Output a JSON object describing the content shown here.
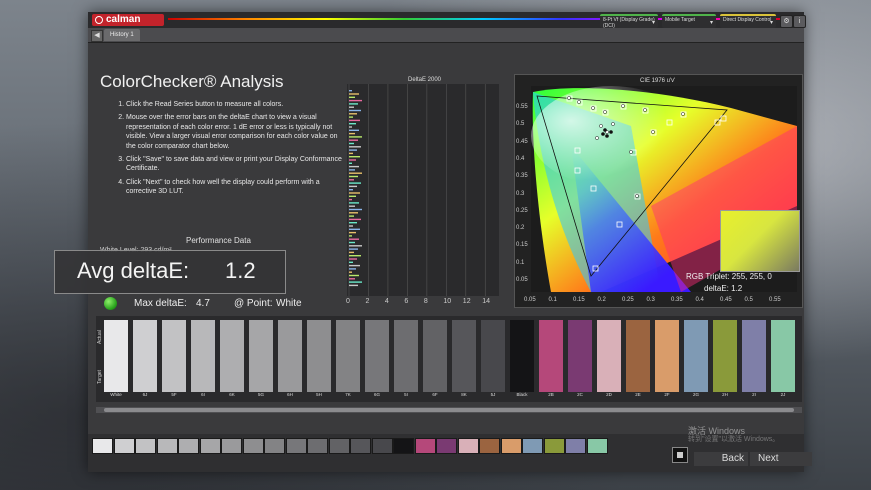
{
  "app": {
    "logo": "calman"
  },
  "tabs": [
    {
      "label": "History 1"
    }
  ],
  "toolbar": {
    "selects": [
      {
        "text": "8-Pt Vf (Display Grade) (DCI)",
        "color": "#4fb34a"
      },
      {
        "text": "Mobile Target",
        "color": "#4fb34a"
      },
      {
        "text": "Direct Display Control",
        "color": "#d9c23a"
      }
    ]
  },
  "instructions": {
    "title": "ColorChecker® Analysis",
    "steps": [
      "Click the Read Series button to measure all colors.",
      "Mouse over the error bars on the deltaE chart to view a visual representation of each color error. 1 dE error or less is typically not visible. View a larger visual error comparison for each color value on the color comparator chart below.",
      "Click \"Save\" to save data and view or print your Display Conformance Certificate.",
      "Click \"Next\" to check how well the display could perform with a corrective 3D LUT."
    ]
  },
  "performance": {
    "title": "Performance Data",
    "sub": "White Level: 293 cd/m²"
  },
  "overlay": {
    "label": "Avg deltaE:",
    "value": "1.2"
  },
  "max_delta": {
    "label": "Max deltaE:",
    "value": "4.7",
    "point_label": "@ Point:",
    "point": "White"
  },
  "status_color": "#28a21c",
  "deltae_chart": {
    "title": "DeltaE 2000",
    "xticks": [
      "0",
      "2",
      "4",
      "6",
      "8",
      "10",
      "12",
      "14"
    ],
    "xmax": 15
  },
  "cie_chart": {
    "title": "CIE 1976 u'v'",
    "yticks": [
      "0.55",
      "0.5",
      "0.45",
      "0.4",
      "0.35",
      "0.3",
      "0.25",
      "0.2",
      "0.15",
      "0.1",
      "0.05"
    ],
    "xticks": [
      "0.05",
      "0.1",
      "0.15",
      "0.2",
      "0.25",
      "0.3",
      "0.35",
      "0.4",
      "0.45",
      "0.5",
      "0.55"
    ],
    "rgb_triplet": "RGB Triplet: 255, 255, 0",
    "deltae": "deltaE: 1.2"
  },
  "swatches": {
    "side_actual": "Actual",
    "side_target": "Target",
    "items": [
      {
        "label": "White",
        "color": "#e8e8ea"
      },
      {
        "label": "6J",
        "color": "#cfcfd1"
      },
      {
        "label": "5F",
        "color": "#c2c2c4"
      },
      {
        "label": "6I",
        "color": "#b8b8ba"
      },
      {
        "label": "6K",
        "color": "#aeaeb0"
      },
      {
        "label": "5G",
        "color": "#a6a6a8"
      },
      {
        "label": "6H",
        "color": "#9a9a9c"
      },
      {
        "label": "5H",
        "color": "#8e8e90"
      },
      {
        "label": "7K",
        "color": "#838385"
      },
      {
        "label": "6G",
        "color": "#77777a"
      },
      {
        "label": "5I",
        "color": "#6d6d70"
      },
      {
        "label": "6F",
        "color": "#626265"
      },
      {
        "label": "8K",
        "color": "#56565a"
      },
      {
        "label": "5J",
        "color": "#48484c"
      },
      {
        "label": "Black",
        "color": "#141416"
      },
      {
        "label": "2B",
        "color": "#b5487a"
      },
      {
        "label": "2C",
        "color": "#7a3a72"
      },
      {
        "label": "2D",
        "color": "#d9b0b8"
      },
      {
        "label": "2E",
        "color": "#9b6440"
      },
      {
        "label": "2F",
        "color": "#d99c6a"
      },
      {
        "label": "2G",
        "color": "#7f9ab4"
      },
      {
        "label": "2H",
        "color": "#8a9a3a"
      },
      {
        "label": "2I",
        "color": "#7f7fa8"
      },
      {
        "label": "2J",
        "color": "#88c8a6"
      }
    ]
  },
  "bottom": {
    "back": "Back",
    "next": "Next",
    "watermark": "激活 Windows",
    "watermark_sub": "转到\"设置\"以激活 Windows。"
  }
}
